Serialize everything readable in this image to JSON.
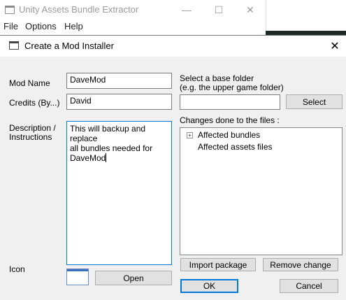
{
  "parent_window": {
    "title": "Unity Assets Bundle Extractor",
    "minimize_glyph": "—",
    "maximize_glyph": "☐",
    "close_glyph": "✕",
    "menu": [
      "File",
      "Options",
      "Help"
    ]
  },
  "dialog": {
    "title": "Create a Mod Installer",
    "close_glyph": "✕",
    "mod_name_label": "Mod Name",
    "mod_name_value": "DaveMod",
    "credits_label": "Credits (By...)",
    "credits_value": "David",
    "description_label_1": "Description /",
    "description_label_2": "Instructions",
    "description_lines": [
      "This will backup and replace",
      "all bundles needed for",
      "DaveMod"
    ],
    "base_folder_label_1": "Select a base folder",
    "base_folder_label_2": "(e.g. the upper game folder)",
    "base_folder_value": "",
    "select_button": "Select",
    "changes_label": "Changes done to the files :",
    "tree_items": [
      "Affected bundles",
      "Affected assets files"
    ],
    "expander_glyph": "+",
    "icon_label": "Icon",
    "open_button": "Open",
    "import_button": "Import package",
    "remove_button": "Remove change",
    "ok_button": "OK",
    "cancel_button": "Cancel"
  },
  "icons": {
    "app_icon": "window-icon",
    "dialog_icon": "window-icon"
  },
  "colors": {
    "focus_border": "#0078d7",
    "dialog_bg": "#f0f0f0",
    "button_bg": "#e1e1e1"
  }
}
